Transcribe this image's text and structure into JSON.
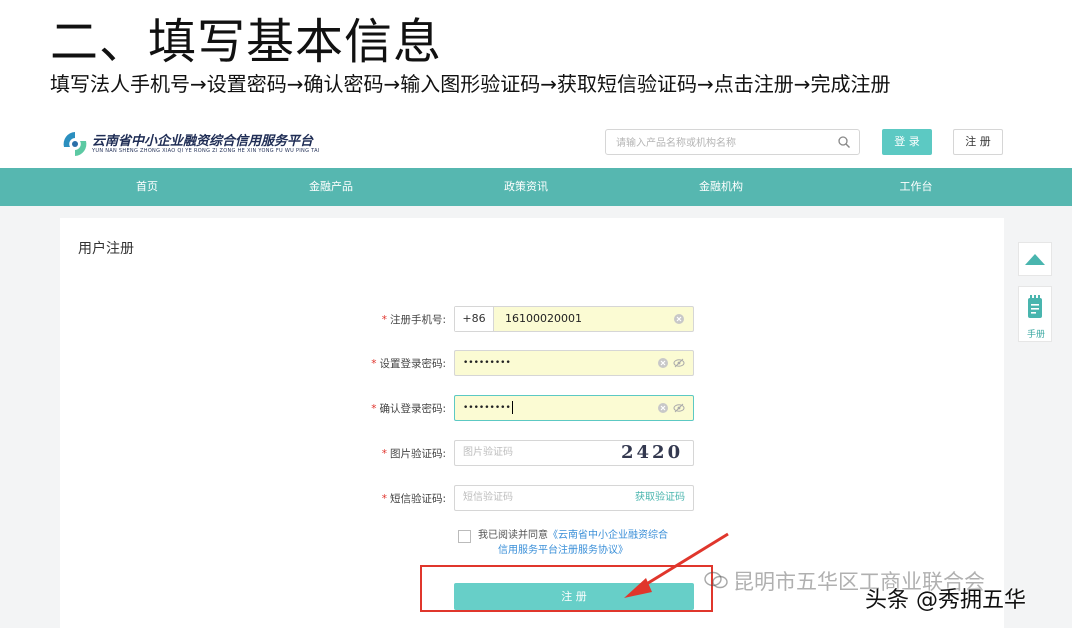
{
  "slide": {
    "title": "二、填写基本信息",
    "subtitle": "填写法人手机号→设置密码→确认密码→输入图形验证码→获取短信验证码→点击注册→完成注册"
  },
  "header": {
    "brand_name": "云南省中小企业融资综合信用服务平台",
    "brand_pinyin": "YUN NAN SHENG ZHONG XIAO QI YE RONG ZI ZONG HE XIN YONG FU WU PING TAI",
    "search_placeholder": "请输入产品名称或机构名称",
    "login_label": "登 录",
    "register_label": "注 册"
  },
  "nav": {
    "items": [
      "首页",
      "金融产品",
      "政策资讯",
      "金融机构",
      "工作台"
    ]
  },
  "form": {
    "title": "用户注册",
    "required_mark": "*",
    "phone_label": "注册手机号:",
    "phone_prefix": "+86",
    "phone_value": "16100020001",
    "password_label": "设置登录密码:",
    "password_value": "•••••••••",
    "confirm_label": "确认登录密码:",
    "confirm_value": "•••••••••",
    "captcha_label": "图片验证码:",
    "captcha_placeholder": "图片验证码",
    "captcha_text": "2420",
    "sms_label": "短信验证码:",
    "sms_placeholder": "短信验证码",
    "sms_get_code": "获取验证码",
    "agree_prefix": "我已阅读并同意",
    "agree_link_1": "《云南省中小企业融资综合",
    "agree_link_2": "信用服务平台注册服务协议》",
    "submit_label": "注 册"
  },
  "sidebar": {
    "manual_label": "手册"
  },
  "watermarks": {
    "org": "昆明市五华区工商业联合会",
    "toutiao": "头条 @秀拥五华"
  },
  "colors": {
    "teal_nav": "#56b7b0",
    "teal_button": "#5cc9c3",
    "required": "#e0332c",
    "highlight": "#e0362c",
    "autofill": "#fbfbd3"
  }
}
